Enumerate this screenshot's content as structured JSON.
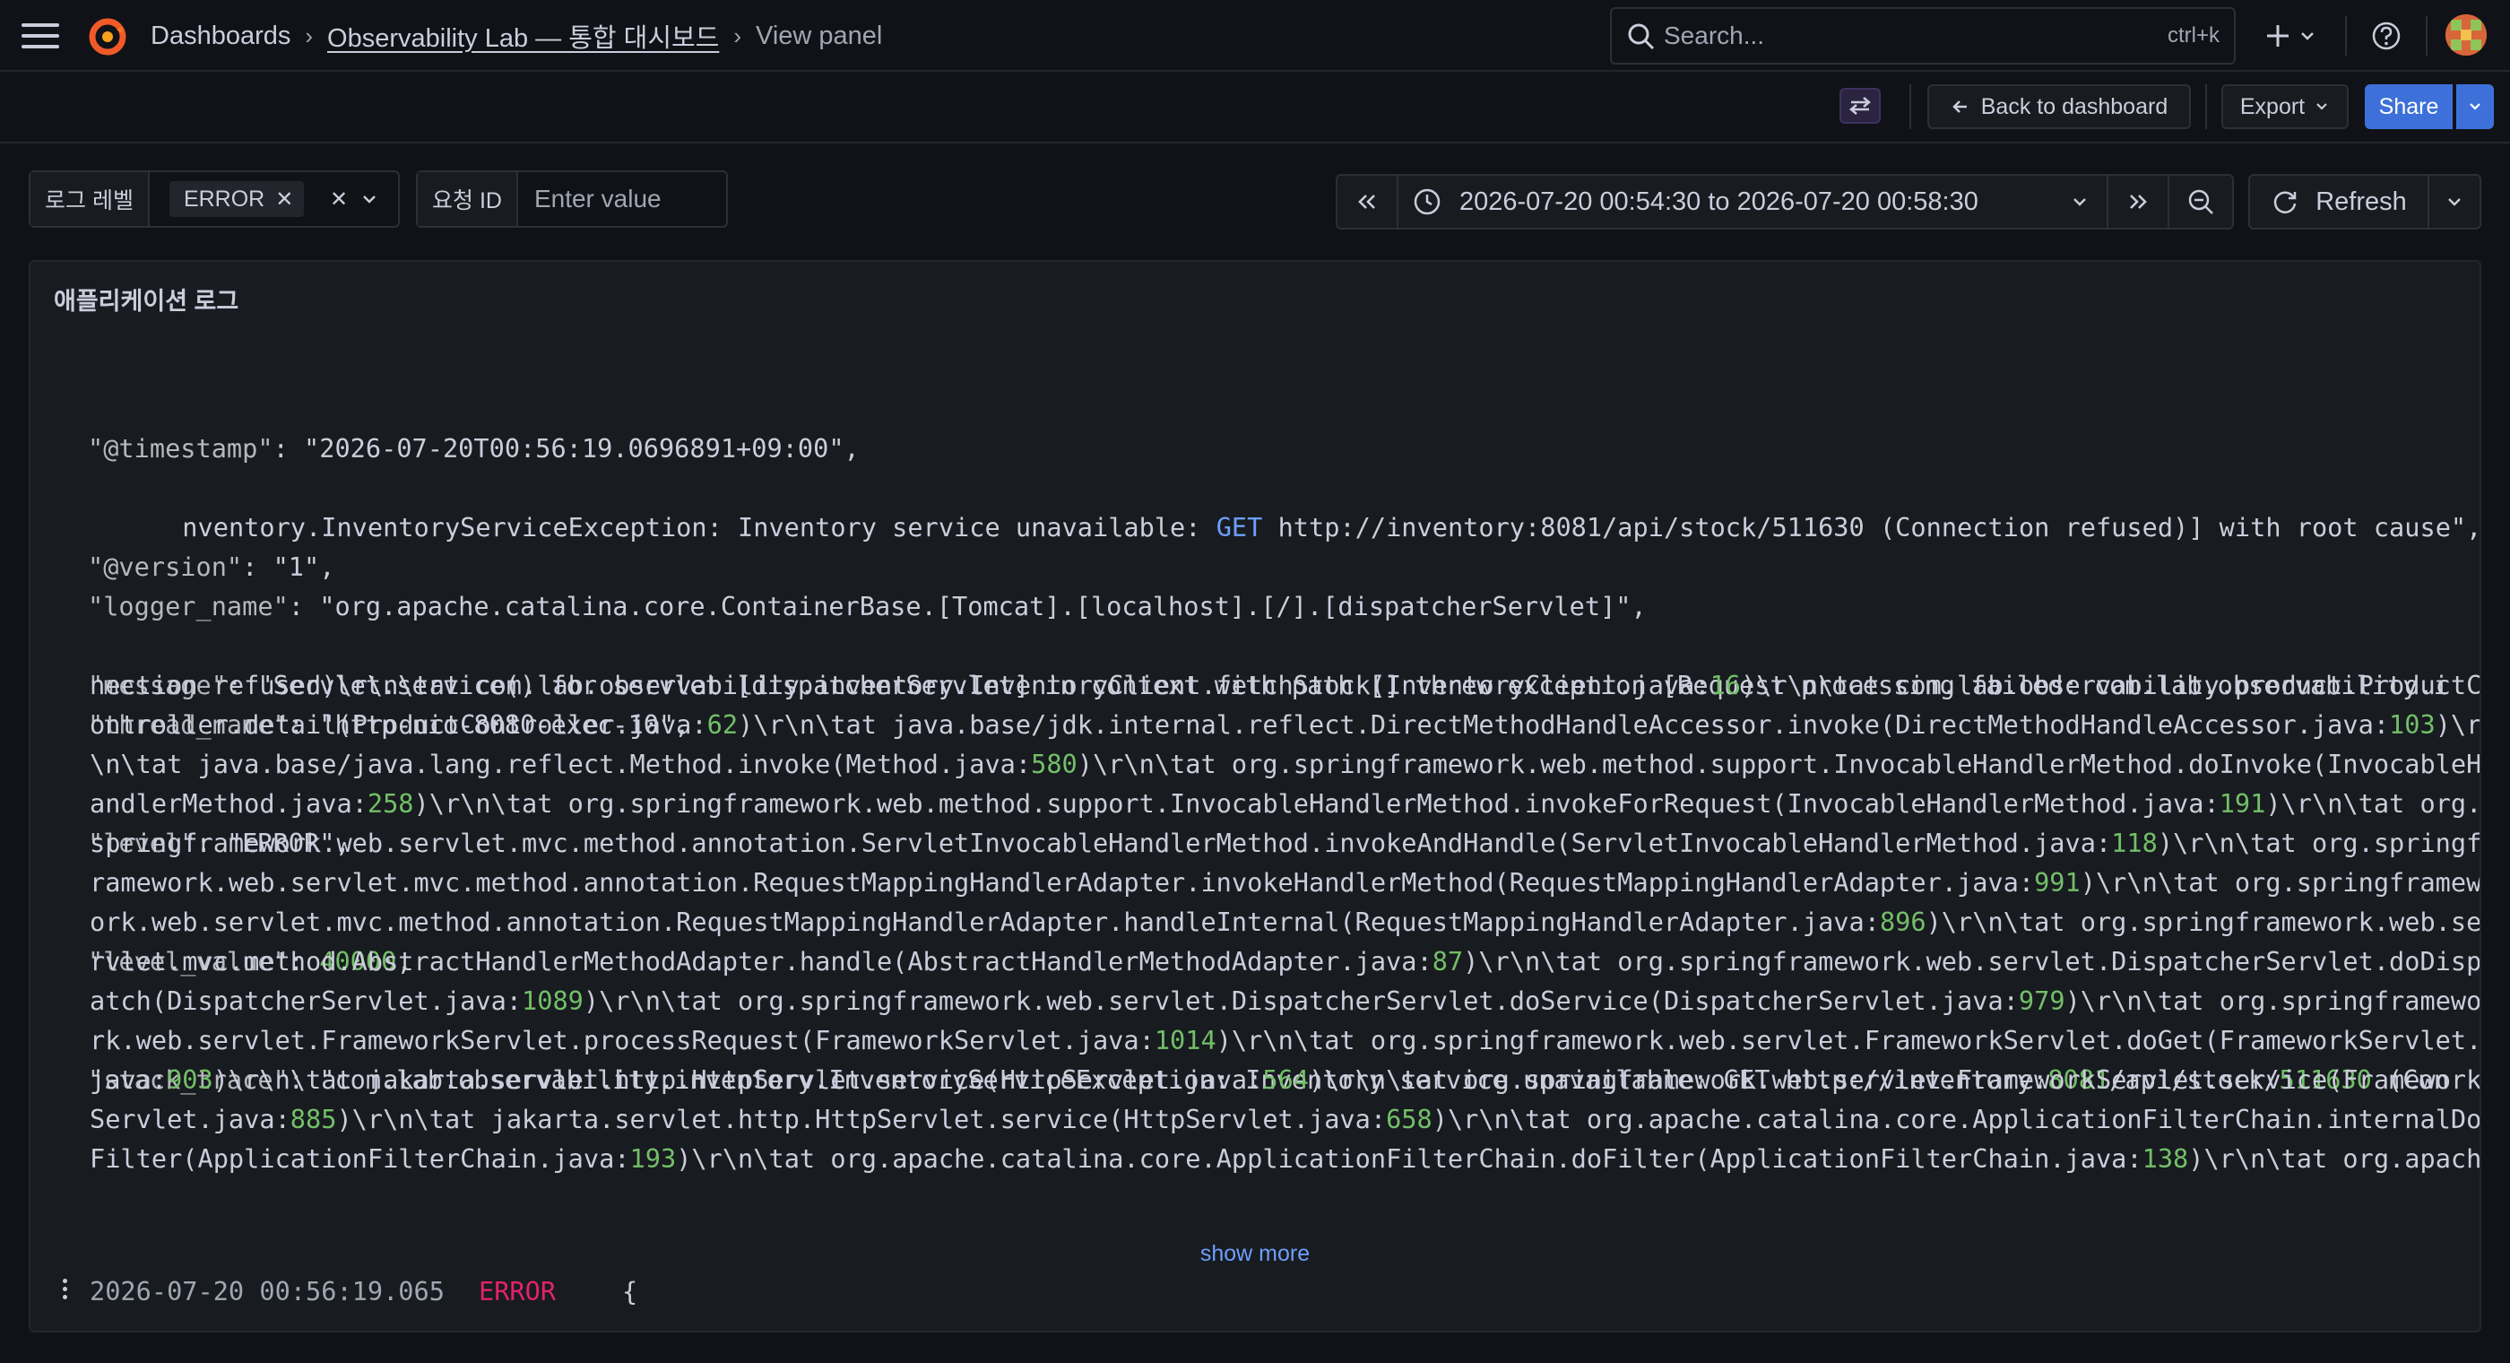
{
  "header": {
    "breadcrumbs": [
      "Dashboards",
      "Observability Lab — 통합 대시보드",
      "View panel"
    ],
    "search_placeholder": "Search...",
    "search_shortcut": "ctrl+k"
  },
  "toolbar": {
    "back_label": "Back to dashboard",
    "export_label": "Export",
    "share_label": "Share"
  },
  "filters": {
    "log_level_label": "로그 레벨",
    "log_level_value": "ERROR",
    "request_id_label": "요청 ID",
    "request_id_placeholder": "Enter value"
  },
  "time_range": {
    "text": "2026-07-20 00:54:30 to 2026-07-20 00:58:30",
    "refresh_label": "Refresh"
  },
  "panel": {
    "title": "애플리케이션 로그",
    "lines": [
      {
        "key": "\"@timestamp\"",
        "rest": ": \"2026-07-20T00:56:19.0696891+09:00\","
      },
      {
        "key": "\"@version\"",
        "rest": ": \"1\","
      },
      {
        "key": "\"message\"",
        "rest": ": \"Servlet.service() for servlet [dispatcherServlet] in context with path [] threw exception [Request processing failed: com.lab.observability.i"
      }
    ],
    "message_cont_a": "nventory.InventoryServiceException: Inventory service unavailable: ",
    "message_get": "GET",
    "message_cont_b": " http://inventory:8081/api/stock/511630 (Connection refused)] with root cause\",",
    "logger_key": "\"logger_name\"",
    "logger_rest": ": \"org.apache.catalina.core.ContainerBase.[Tomcat].[localhost].[/].[dispatcherServlet]\",",
    "thread_key": "\"thread_name\"",
    "thread_rest": ": \"http-nio-8080-exec-10\",",
    "level_key": "\"level\"",
    "level_rest": ": \"ERROR\",",
    "level_value_key": "\"level_value\"",
    "level_value_num": "40000",
    "stack_key": "\"stack_trace\"",
    "stack_lines": [
      [
        ": \"com.lab.observability.inventory.InventoryServiceException: Inventory service unavailable: GET http://inventory:",
        "8081",
        "/api/stock/",
        "511630",
        " (Con"
      ],
      [
        "nection refused)\\r\\n\\tat com.lab.observability.inventory.InventoryClient.fetchStock(InventoryClient.java:",
        "16",
        ")\\r\\n\\tat com.lab.observability.product.ProductC"
      ],
      [
        "ontroller.detail(ProductController.java:",
        "62",
        ")\\r\\n\\tat java.base/jdk.internal.reflect.DirectMethodHandleAccessor.invoke(DirectMethodHandleAccessor.java:",
        "103",
        ")\\r"
      ],
      [
        "\\n\\tat java.base/java.lang.reflect.Method.invoke(Method.java:",
        "580",
        ")\\r\\n\\tat org.springframework.web.method.support.InvocableHandlerMethod.doInvoke(InvocableH"
      ],
      [
        "andlerMethod.java:",
        "258",
        ")\\r\\n\\tat org.springframework.web.method.support.InvocableHandlerMethod.invokeForRequest(InvocableHandlerMethod.java:",
        "191",
        ")\\r\\n\\tat org."
      ],
      [
        "springframework.web.servlet.mvc.method.annotation.ServletInvocableHandlerMethod.invokeAndHandle(ServletInvocableHandlerMethod.java:",
        "118",
        ")\\r\\n\\tat org.springf"
      ],
      [
        "ramework.web.servlet.mvc.method.annotation.RequestMappingHandlerAdapter.invokeHandlerMethod(RequestMappingHandlerAdapter.java:",
        "991",
        ")\\r\\n\\tat org.springframew"
      ],
      [
        "ork.web.servlet.mvc.method.annotation.RequestMappingHandlerAdapter.handleInternal(RequestMappingHandlerAdapter.java:",
        "896",
        ")\\r\\n\\tat org.springframework.web.se"
      ],
      [
        "rvlet.mvc.method.AbstractHandlerMethodAdapter.handle(AbstractHandlerMethodAdapter.java:",
        "87",
        ")\\r\\n\\tat org.springframework.web.servlet.DispatcherServlet.doDisp"
      ],
      [
        "atch(DispatcherServlet.java:",
        "1089",
        ")\\r\\n\\tat org.springframework.web.servlet.DispatcherServlet.doService(DispatcherServlet.java:",
        "979",
        ")\\r\\n\\tat org.springframewo"
      ],
      [
        "rk.web.servlet.FrameworkServlet.processRequest(FrameworkServlet.java:",
        "1014",
        ")\\r\\n\\tat org.springframework.web.servlet.FrameworkServlet.doGet(FrameworkServlet."
      ],
      [
        "java:",
        "903",
        ")\\r\\n\\tat jakarta.servlet.http.HttpServlet.service(HttpServlet.java:",
        "564",
        ")\\r\\n\\tat org.springframework.web.servlet.FrameworkServlet.service(Framework"
      ],
      [
        "Servlet.java:",
        "885",
        ")\\r\\n\\tat jakarta.servlet.http.HttpServlet.service(HttpServlet.java:",
        "658",
        ")\\r\\n\\tat org.apache.catalina.core.ApplicationFilterChain.internalDo"
      ],
      [
        "Filter(ApplicationFilterChain.java:",
        "193",
        ")\\r\\n\\tat org.apache.catalina.core.ApplicationFilterChain.doFilter(ApplicationFilterChain.java:",
        "138",
        ")\\r\\n\\tat org.apach"
      ]
    ],
    "show_more": "show more",
    "next_row": {
      "timestamp": "2026-07-20 00:56:19.065",
      "level": "ERROR",
      "brace": "{"
    }
  },
  "colors": {
    "background": "#111217",
    "panel": "#181b1f",
    "accent": "#3d71d9",
    "error": "#e0226e",
    "number": "#73bf69",
    "keyword": "#6e9fff"
  }
}
